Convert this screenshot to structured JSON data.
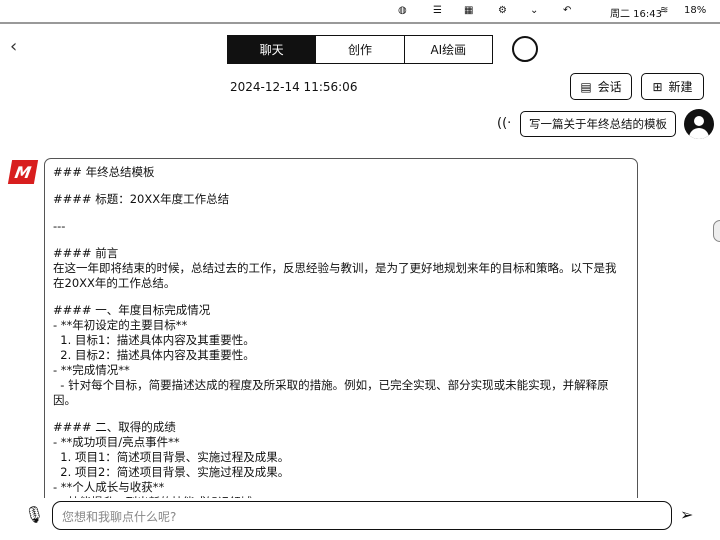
{
  "status": {
    "day_time": "周二 16:43",
    "battery": "18%"
  },
  "tabs": [
    {
      "label": "聊天",
      "active": true
    },
    {
      "label": "创作"
    },
    {
      "label": "AI绘画"
    }
  ],
  "timestamp": "2024-12-14 11:56:06",
  "buttons": {
    "session": "会话",
    "new": "新建"
  },
  "user_message": "写一篇关于年终总结的模板",
  "logo_text": "MB",
  "reply_lines": [
    "### 年终总结模板",
    "",
    "#### 标题：20XX年度工作总结",
    "",
    "---",
    "",
    "#### 前言",
    "在这一年即将结束的时候，总结过去的工作，反思经验与教训，是为了更好地规划来年的目标和策略。以下是我",
    "在20XX年的工作总结。",
    "",
    "#### 一、年度目标完成情况",
    "- **年初设定的主要目标**",
    "  1. 目标1：描述具体内容及其重要性。",
    "  2. 目标2：描述具体内容及其重要性。",
    "- **完成情况**",
    "  - 针对每个目标，简要描述达成的程度及所采取的措施。例如，已完全实现、部分实现或未能实现，并解释原",
    "因。",
    "",
    "#### 二、取得的成绩",
    "- **成功项目/亮点事件**",
    "  1. 项目1：简述项目背景、实施过程及成果。",
    "  2. 项目2：简述项目背景、实施过程及成果。",
    "- **个人成长与收获**",
    "  - 技能提升：列出新的技能或知识领域。"
  ],
  "input": {
    "placeholder": "您想和我聊点什么呢?"
  }
}
